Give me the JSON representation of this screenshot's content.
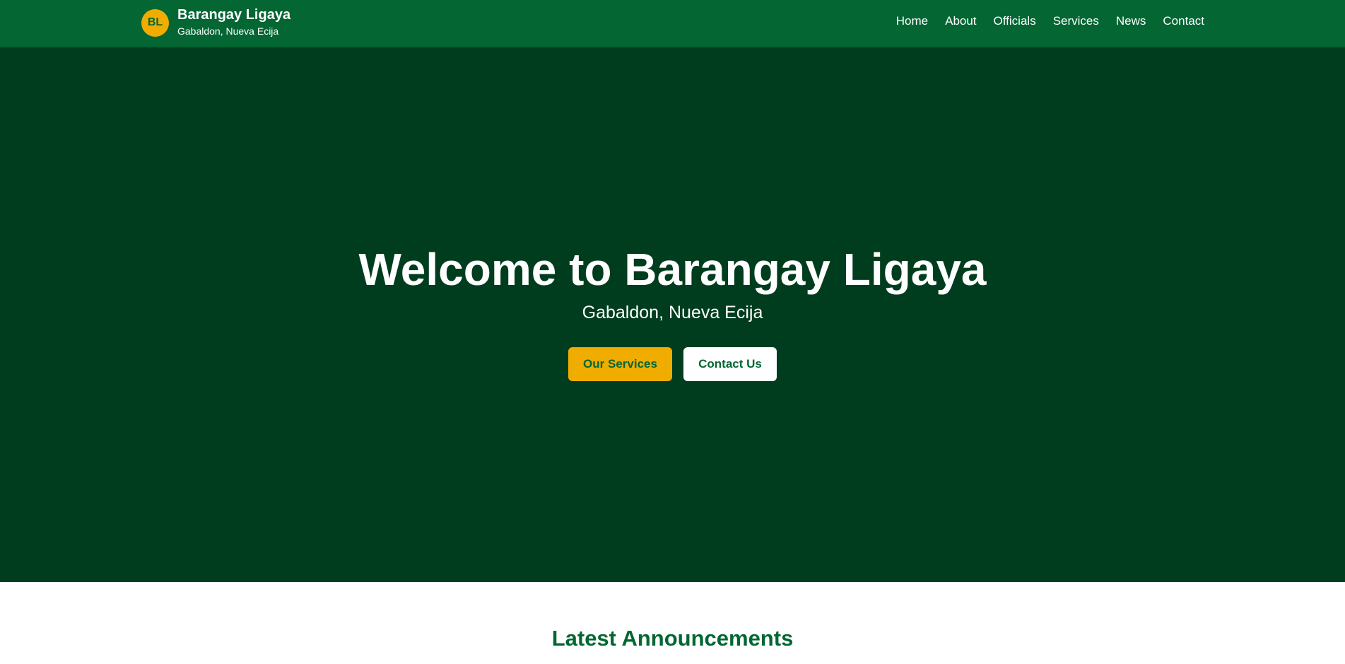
{
  "header": {
    "logo_initials": "BL",
    "brand_name": "Barangay Ligaya",
    "brand_location": "Gabaldon, Nueva Ecija",
    "nav": [
      {
        "label": "Home"
      },
      {
        "label": "About"
      },
      {
        "label": "Officials"
      },
      {
        "label": "Services"
      },
      {
        "label": "News"
      },
      {
        "label": "Contact"
      }
    ]
  },
  "hero": {
    "title": "Welcome to Barangay Ligaya",
    "subtitle": "Gabaldon, Nueva Ecija",
    "primary_button": "Our Services",
    "secondary_button": "Contact Us"
  },
  "announcements": {
    "title": "Latest Announcements"
  },
  "colors": {
    "header_bg": "#036633",
    "hero_bg": "#003d1e",
    "accent": "#f0ad00",
    "text_on_dark": "#ffffff"
  }
}
